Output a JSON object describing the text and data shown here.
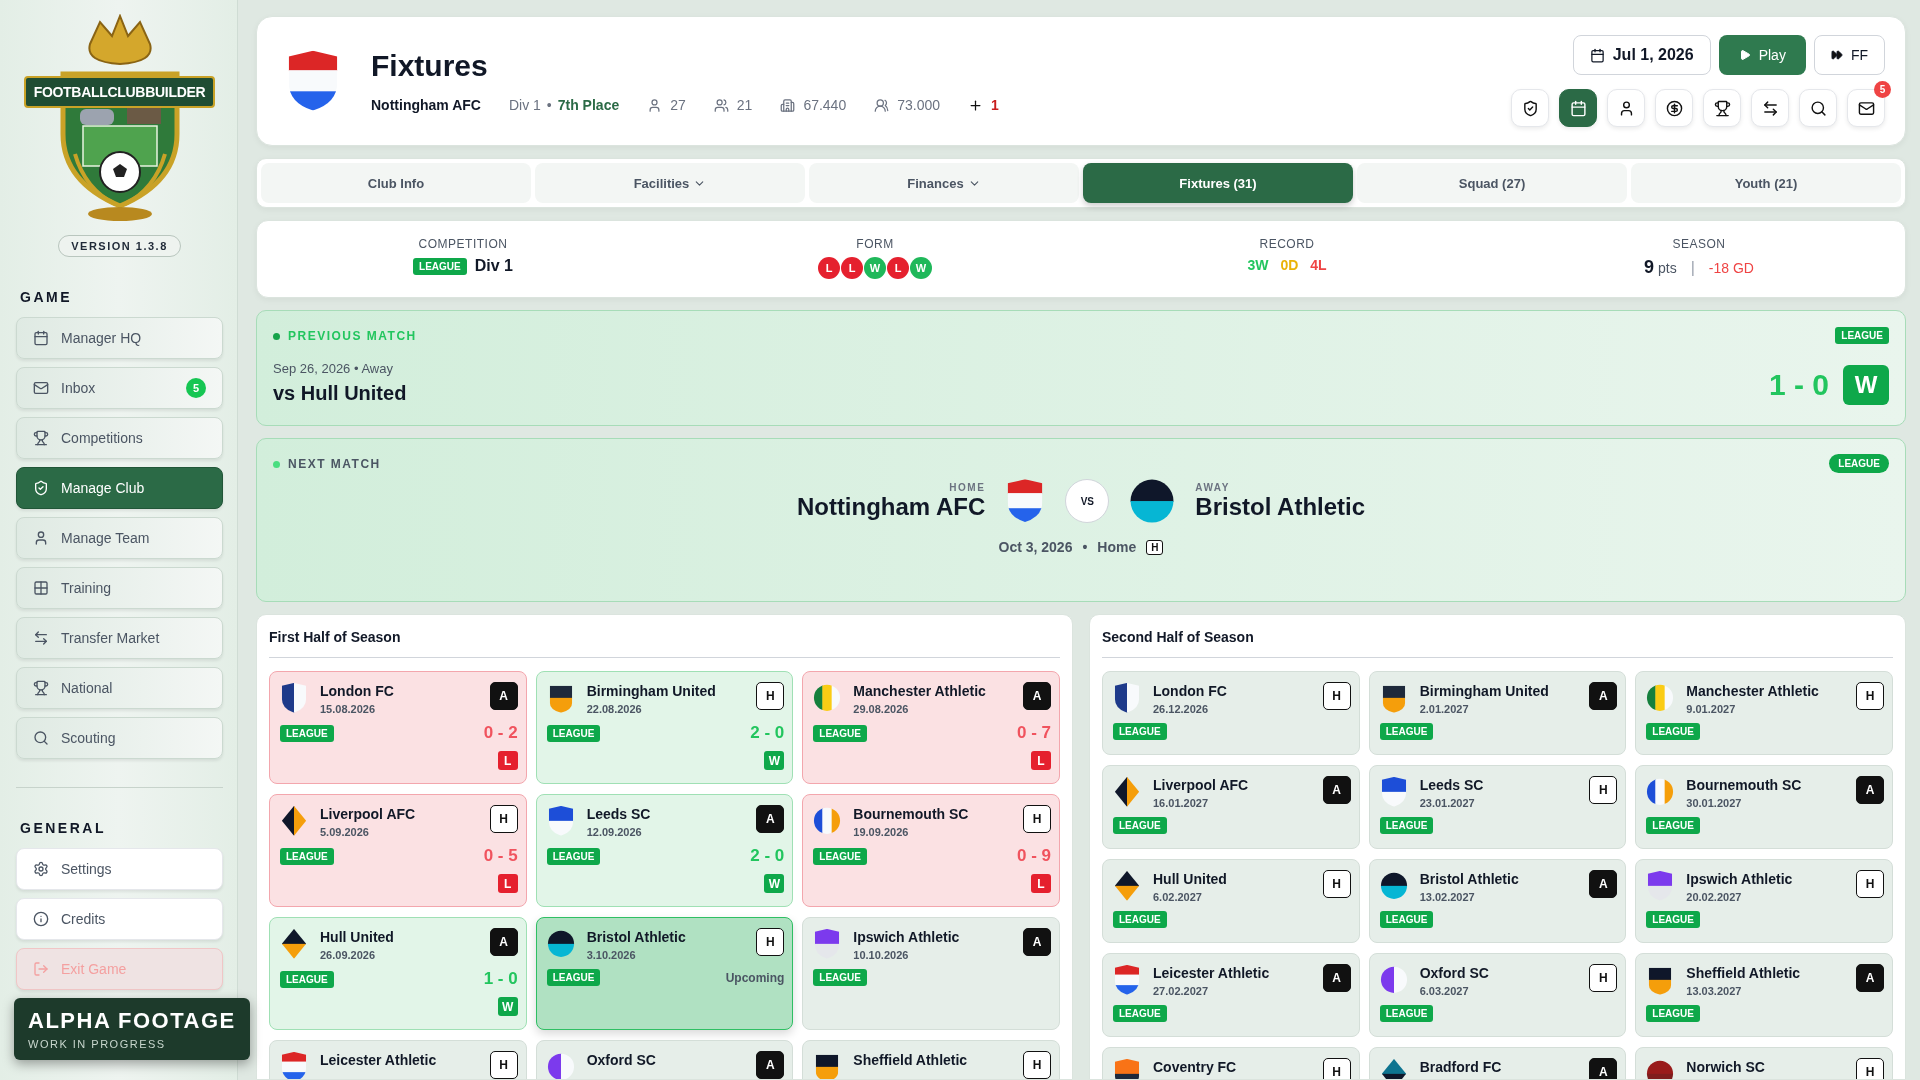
{
  "sidebar": {
    "logo_text": "FOOTBALLCLUBBUILDER",
    "version": "VERSION 1.3.8",
    "sections": [
      {
        "title": "GAME",
        "items": [
          {
            "label": "Manager HQ",
            "selected": false,
            "kind": "normal"
          },
          {
            "label": "Inbox",
            "selected": false,
            "kind": "normal",
            "badge": "5"
          },
          {
            "label": "Competitions",
            "selected": false,
            "kind": "normal"
          },
          {
            "label": "Manage Club",
            "selected": true,
            "kind": "normal"
          },
          {
            "label": "Manage Team",
            "selected": false,
            "kind": "normal"
          },
          {
            "label": "Training",
            "selected": false,
            "kind": "normal"
          },
          {
            "label": "Transfer Market",
            "selected": false,
            "kind": "normal"
          },
          {
            "label": "National",
            "selected": false,
            "kind": "normal"
          },
          {
            "label": "Scouting",
            "selected": false,
            "kind": "normal"
          }
        ]
      },
      {
        "title": "GENERAL",
        "items": [
          {
            "label": "Settings",
            "selected": false,
            "kind": "plain"
          },
          {
            "label": "Credits",
            "selected": false,
            "kind": "plain"
          },
          {
            "label": "Exit Game",
            "selected": false,
            "kind": "danger"
          }
        ]
      }
    ]
  },
  "overlay": {
    "title": "ALPHA FOOTAGE",
    "subtitle": "WORK IN PROGRESS"
  },
  "header": {
    "title": "Fixtures",
    "club": "Nottingham AFC",
    "division": "Div 1",
    "separator": "•",
    "place": "7th Place",
    "stats": [
      {
        "value": "27",
        "kind": "plain"
      },
      {
        "value": "21",
        "kind": "plain"
      },
      {
        "value": "67.440",
        "kind": "plain"
      },
      {
        "value": "73.000",
        "kind": "plain"
      },
      {
        "value": "1",
        "kind": "alert"
      }
    ],
    "date": "Jul 1, 2026",
    "play": "Play",
    "ff": "FF",
    "toolbar": [
      {
        "selected": false
      },
      {
        "selected": true
      },
      {
        "selected": false
      },
      {
        "selected": false
      },
      {
        "selected": false
      },
      {
        "selected": false
      },
      {
        "selected": false
      },
      {
        "selected": false,
        "badge": "5"
      }
    ]
  },
  "tabs": [
    {
      "label": "Club Info",
      "selected": false
    },
    {
      "label": "Facilities",
      "selected": false,
      "dropdown": true
    },
    {
      "label": "Finances",
      "selected": false,
      "dropdown": true
    },
    {
      "label": "Fixtures (31)",
      "selected": true
    },
    {
      "label": "Squad (27)",
      "selected": false
    },
    {
      "label": "Youth (21)",
      "selected": false
    }
  ],
  "summary": {
    "competition": {
      "label": "COMPETITION",
      "tag": "LEAGUE",
      "value": "Div 1"
    },
    "form": {
      "label": "FORM",
      "results": [
        {
          "label": "L",
          "kind": "loss"
        },
        {
          "label": "L",
          "kind": "loss"
        },
        {
          "label": "W",
          "kind": "win"
        },
        {
          "label": "L",
          "kind": "loss"
        },
        {
          "label": "W",
          "kind": "win"
        }
      ]
    },
    "record": {
      "label": "RECORD",
      "parts": [
        {
          "label": "3W",
          "kind": "win"
        },
        {
          "label": "0D",
          "kind": "draw"
        },
        {
          "label": "4L",
          "kind": "loss"
        }
      ]
    },
    "season": {
      "label": "SEASON",
      "points": "9",
      "unit": "pts",
      "separator": "|",
      "goal_difference": "-18 GD"
    }
  },
  "previous_match": {
    "title": "PREVIOUS MATCH",
    "meta": "Sep 26, 2026 • Away",
    "opponent": "vs Hull United",
    "tag": "LEAGUE",
    "score": "1 - 0",
    "result": {
      "label": "W",
      "kind": "win"
    }
  },
  "next_match": {
    "title": "NEXT MATCH",
    "tag": "LEAGUE",
    "home_label": "HOME",
    "home": "Nottingham AFC",
    "vs": "VS",
    "away_label": "AWAY",
    "away": "Bristol Athletic",
    "date": "Oct 3, 2026",
    "separator": "•",
    "venue": "Home",
    "venue_badge": "H"
  },
  "halves": [
    {
      "title": "First Half of Season",
      "fixtures": [
        {
          "team": "London FC",
          "date": "15.08.2026",
          "venue": "A",
          "away": true,
          "tag": "LEAGUE",
          "score": "0 - 2",
          "result": {
            "label": "L",
            "kind": "loss"
          },
          "selected": false
        },
        {
          "team": "Birmingham United",
          "date": "22.08.2026",
          "venue": "H",
          "away": false,
          "tag": "LEAGUE",
          "score": "2 - 0",
          "result": {
            "label": "W",
            "kind": "win"
          },
          "selected": false
        },
        {
          "team": "Manchester Athletic",
          "date": "29.08.2026",
          "venue": "A",
          "away": true,
          "tag": "LEAGUE",
          "score": "0 - 7",
          "result": {
            "label": "L",
            "kind": "loss"
          },
          "selected": false
        },
        {
          "team": "Liverpool AFC",
          "date": "5.09.2026",
          "venue": "H",
          "away": false,
          "tag": "LEAGUE",
          "score": "0 - 5",
          "result": {
            "label": "L",
            "kind": "loss"
          },
          "selected": false
        },
        {
          "team": "Leeds SC",
          "date": "12.09.2026",
          "venue": "A",
          "away": true,
          "tag": "LEAGUE",
          "score": "2 - 0",
          "result": {
            "label": "W",
            "kind": "win"
          },
          "selected": false
        },
        {
          "team": "Bournemouth SC",
          "date": "19.09.2026",
          "venue": "H",
          "away": false,
          "tag": "LEAGUE",
          "score": "0 - 9",
          "result": {
            "label": "L",
            "kind": "loss"
          },
          "selected": false
        },
        {
          "team": "Hull United",
          "date": "26.09.2026",
          "venue": "A",
          "away": true,
          "tag": "LEAGUE",
          "score": "1 - 0",
          "result": {
            "label": "W",
            "kind": "win"
          },
          "selected": false
        },
        {
          "team": "Bristol Athletic",
          "date": "3.10.2026",
          "venue": "H",
          "away": false,
          "tag": "LEAGUE",
          "status": "Upcoming",
          "selected": true
        },
        {
          "team": "Ipswich Athletic",
          "date": "10.10.2026",
          "venue": "A",
          "away": true,
          "tag": "LEAGUE",
          "selected": false
        },
        {
          "team": "Leicester Athletic",
          "venue": "H",
          "away": false,
          "selected": false
        },
        {
          "team": "Oxford SC",
          "venue": "A",
          "away": true,
          "selected": false
        },
        {
          "team": "Sheffield Athletic",
          "venue": "H",
          "away": false,
          "selected": false
        }
      ]
    },
    {
      "title": "Second Half of Season",
      "fixtures": [
        {
          "team": "London FC",
          "date": "26.12.2026",
          "venue": "H",
          "away": false,
          "tag": "LEAGUE",
          "selected": false
        },
        {
          "team": "Birmingham United",
          "date": "2.01.2027",
          "venue": "A",
          "away": true,
          "tag": "LEAGUE",
          "selected": false
        },
        {
          "team": "Manchester Athletic",
          "date": "9.01.2027",
          "venue": "H",
          "away": false,
          "tag": "LEAGUE",
          "selected": false
        },
        {
          "team": "Liverpool AFC",
          "date": "16.01.2027",
          "venue": "A",
          "away": true,
          "tag": "LEAGUE",
          "selected": false
        },
        {
          "team": "Leeds SC",
          "date": "23.01.2027",
          "venue": "H",
          "away": false,
          "tag": "LEAGUE",
          "selected": false
        },
        {
          "team": "Bournemouth SC",
          "date": "30.01.2027",
          "venue": "A",
          "away": true,
          "tag": "LEAGUE",
          "selected": false
        },
        {
          "team": "Hull United",
          "date": "6.02.2027",
          "venue": "H",
          "away": false,
          "tag": "LEAGUE",
          "selected": false
        },
        {
          "team": "Bristol Athletic",
          "date": "13.02.2027",
          "venue": "A",
          "away": true,
          "tag": "LEAGUE",
          "selected": false
        },
        {
          "team": "Ipswich Athletic",
          "date": "20.02.2027",
          "venue": "H",
          "away": false,
          "tag": "LEAGUE",
          "selected": false
        },
        {
          "team": "Leicester Athletic",
          "date": "27.02.2027",
          "venue": "A",
          "away": true,
          "tag": "LEAGUE",
          "selected": false
        },
        {
          "team": "Oxford SC",
          "date": "6.03.2027",
          "venue": "H",
          "away": false,
          "tag": "LEAGUE",
          "selected": false
        },
        {
          "team": "Sheffield Athletic",
          "date": "13.03.2027",
          "venue": "A",
          "away": true,
          "tag": "LEAGUE",
          "selected": false
        },
        {
          "team": "Coventry FC",
          "venue": "H",
          "away": false,
          "selected": false
        },
        {
          "team": "Bradford FC",
          "venue": "A",
          "away": true,
          "selected": false
        },
        {
          "team": "Norwich SC",
          "venue": "H",
          "away": false,
          "selected": false
        }
      ]
    }
  ]
}
